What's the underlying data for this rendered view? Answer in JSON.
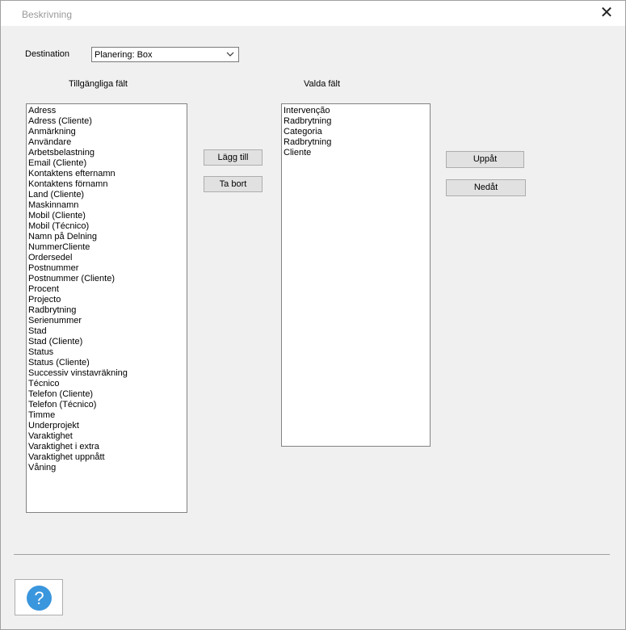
{
  "window": {
    "title": "Beskrivning"
  },
  "destination": {
    "label": "Destination",
    "selected": "Planering:  Box"
  },
  "available": {
    "header": "Tillgängliga fält",
    "items": [
      "Adress",
      "Adress (Cliente)",
      "Anmärkning",
      "Användare",
      "Arbetsbelastning",
      "Email (Cliente)",
      "Kontaktens efternamn",
      "Kontaktens förnamn",
      "Land (Cliente)",
      "Maskinnamn",
      "Mobil (Cliente)",
      "Mobil (Técnico)",
      "Namn på Delning",
      "NummerCliente",
      "Ordersedel",
      "Postnummer",
      "Postnummer  (Cliente)",
      "Procent",
      "Projecto",
      "Radbrytning",
      "Serienummer",
      "Stad",
      "Stad  (Cliente)",
      "Status",
      "Status (Cliente)",
      "Successiv vinstavräkning",
      "Técnico",
      "Telefon (Cliente)",
      "Telefon (Técnico)",
      "Timme",
      "Underprojekt",
      "Varaktighet",
      "Varaktighet i extra",
      "Varaktighet uppnått",
      "Våning"
    ]
  },
  "selected": {
    "header": "Valda fält",
    "items": [
      "Intervenção",
      "Radbrytning",
      "Categoria",
      "Radbrytning",
      "Cliente"
    ]
  },
  "buttons": {
    "add": "Lägg till",
    "remove": "Ta bort",
    "up": "Uppåt",
    "down": "Nedåt",
    "help": "?"
  },
  "icons": {
    "close": "close-icon",
    "dropdown": "chevron-down-icon",
    "help": "help-icon"
  },
  "colors": {
    "help_accent": "#3a96dd"
  }
}
